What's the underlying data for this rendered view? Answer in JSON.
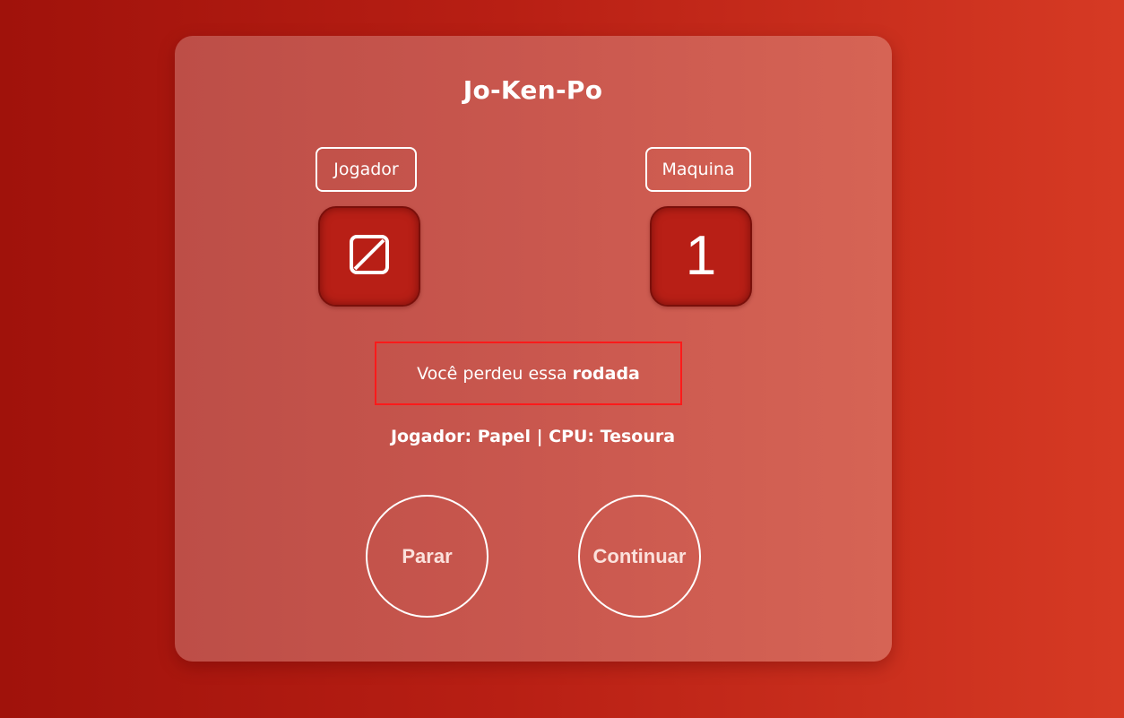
{
  "game": {
    "title": "Jo-Ken-Po"
  },
  "player": {
    "label": "Jogador",
    "score_icon": "no-score-icon"
  },
  "cpu": {
    "label": "Maquina",
    "score": "1"
  },
  "result": {
    "prefix": "Você perdeu essa",
    "emphasis": "rodada"
  },
  "picks": {
    "text": "Jogador: Papel | CPU: Tesoura"
  },
  "buttons": {
    "stop_label": "Parar",
    "continue_label": "Continuar"
  },
  "colors": {
    "result_border": "#ff1a1a",
    "score_box": "#b81f16"
  }
}
